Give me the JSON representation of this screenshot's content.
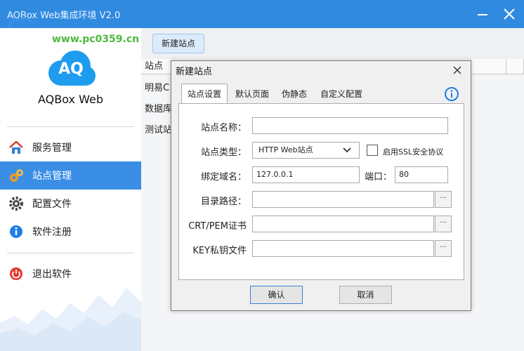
{
  "window": {
    "title": "AQBox Web集成环境 V2.0"
  },
  "watermark": "www.pc0359.cn",
  "sidebar": {
    "logo_text": "AQ",
    "brand": "AQBox Web",
    "items": [
      {
        "label": "服务管理",
        "icon": "home-icon"
      },
      {
        "label": "站点管理",
        "icon": "gears-icon"
      },
      {
        "label": "配置文件",
        "icon": "gear-icon"
      },
      {
        "label": "软件注册",
        "icon": "info-icon"
      },
      {
        "label": "退出软件",
        "icon": "power-icon"
      }
    ],
    "active_index": 1
  },
  "main": {
    "new_site_button": "新建站点",
    "table_header": "站点",
    "rows": [
      "明易C",
      "数据库",
      "测试站"
    ]
  },
  "dialog": {
    "title": "新建站点",
    "tabs": [
      "站点设置",
      "默认页面",
      "伪静态",
      "自定义配置"
    ],
    "active_tab": 0,
    "form": {
      "site_name_label": "站点名称：",
      "site_name_value": "",
      "site_type_label": "站点类型：",
      "site_type_value": "HTTP Web站点",
      "ssl_label": "启用SSL安全协议",
      "domain_label": "绑定域名：",
      "domain_value": "127.0.0.1",
      "port_label": "端口：",
      "port_value": "80",
      "dir_label": "目录路径：",
      "dir_value": "",
      "cert_label": "CRT/PEM证书",
      "cert_value": "",
      "key_label": "KEY私钥文件",
      "key_value": "",
      "browse_label": "···"
    },
    "ok_button": "确认",
    "cancel_button": "取消"
  },
  "colors": {
    "accent": "#3a8ee6",
    "titlebar": "#2f8ae0"
  }
}
